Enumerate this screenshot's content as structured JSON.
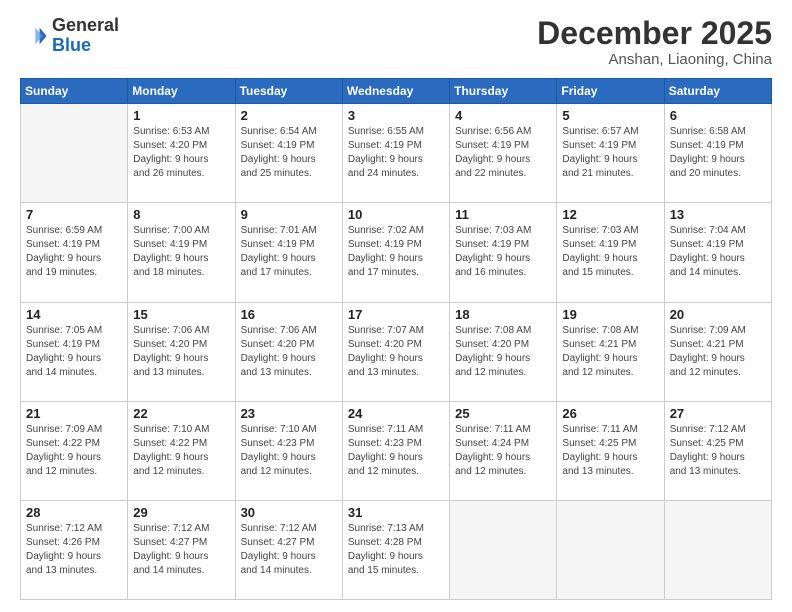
{
  "logo": {
    "line1": "General",
    "line2": "Blue"
  },
  "header": {
    "month": "December 2025",
    "location": "Anshan, Liaoning, China"
  },
  "days_of_week": [
    "Sunday",
    "Monday",
    "Tuesday",
    "Wednesday",
    "Thursday",
    "Friday",
    "Saturday"
  ],
  "weeks": [
    [
      {
        "day": "",
        "info": ""
      },
      {
        "day": "1",
        "info": "Sunrise: 6:53 AM\nSunset: 4:20 PM\nDaylight: 9 hours\nand 26 minutes."
      },
      {
        "day": "2",
        "info": "Sunrise: 6:54 AM\nSunset: 4:19 PM\nDaylight: 9 hours\nand 25 minutes."
      },
      {
        "day": "3",
        "info": "Sunrise: 6:55 AM\nSunset: 4:19 PM\nDaylight: 9 hours\nand 24 minutes."
      },
      {
        "day": "4",
        "info": "Sunrise: 6:56 AM\nSunset: 4:19 PM\nDaylight: 9 hours\nand 22 minutes."
      },
      {
        "day": "5",
        "info": "Sunrise: 6:57 AM\nSunset: 4:19 PM\nDaylight: 9 hours\nand 21 minutes."
      },
      {
        "day": "6",
        "info": "Sunrise: 6:58 AM\nSunset: 4:19 PM\nDaylight: 9 hours\nand 20 minutes."
      }
    ],
    [
      {
        "day": "7",
        "info": "Sunrise: 6:59 AM\nSunset: 4:19 PM\nDaylight: 9 hours\nand 19 minutes."
      },
      {
        "day": "8",
        "info": "Sunrise: 7:00 AM\nSunset: 4:19 PM\nDaylight: 9 hours\nand 18 minutes."
      },
      {
        "day": "9",
        "info": "Sunrise: 7:01 AM\nSunset: 4:19 PM\nDaylight: 9 hours\nand 17 minutes."
      },
      {
        "day": "10",
        "info": "Sunrise: 7:02 AM\nSunset: 4:19 PM\nDaylight: 9 hours\nand 17 minutes."
      },
      {
        "day": "11",
        "info": "Sunrise: 7:03 AM\nSunset: 4:19 PM\nDaylight: 9 hours\nand 16 minutes."
      },
      {
        "day": "12",
        "info": "Sunrise: 7:03 AM\nSunset: 4:19 PM\nDaylight: 9 hours\nand 15 minutes."
      },
      {
        "day": "13",
        "info": "Sunrise: 7:04 AM\nSunset: 4:19 PM\nDaylight: 9 hours\nand 14 minutes."
      }
    ],
    [
      {
        "day": "14",
        "info": "Sunrise: 7:05 AM\nSunset: 4:19 PM\nDaylight: 9 hours\nand 14 minutes."
      },
      {
        "day": "15",
        "info": "Sunrise: 7:06 AM\nSunset: 4:20 PM\nDaylight: 9 hours\nand 13 minutes."
      },
      {
        "day": "16",
        "info": "Sunrise: 7:06 AM\nSunset: 4:20 PM\nDaylight: 9 hours\nand 13 minutes."
      },
      {
        "day": "17",
        "info": "Sunrise: 7:07 AM\nSunset: 4:20 PM\nDaylight: 9 hours\nand 13 minutes."
      },
      {
        "day": "18",
        "info": "Sunrise: 7:08 AM\nSunset: 4:20 PM\nDaylight: 9 hours\nand 12 minutes."
      },
      {
        "day": "19",
        "info": "Sunrise: 7:08 AM\nSunset: 4:21 PM\nDaylight: 9 hours\nand 12 minutes."
      },
      {
        "day": "20",
        "info": "Sunrise: 7:09 AM\nSunset: 4:21 PM\nDaylight: 9 hours\nand 12 minutes."
      }
    ],
    [
      {
        "day": "21",
        "info": "Sunrise: 7:09 AM\nSunset: 4:22 PM\nDaylight: 9 hours\nand 12 minutes."
      },
      {
        "day": "22",
        "info": "Sunrise: 7:10 AM\nSunset: 4:22 PM\nDaylight: 9 hours\nand 12 minutes."
      },
      {
        "day": "23",
        "info": "Sunrise: 7:10 AM\nSunset: 4:23 PM\nDaylight: 9 hours\nand 12 minutes."
      },
      {
        "day": "24",
        "info": "Sunrise: 7:11 AM\nSunset: 4:23 PM\nDaylight: 9 hours\nand 12 minutes."
      },
      {
        "day": "25",
        "info": "Sunrise: 7:11 AM\nSunset: 4:24 PM\nDaylight: 9 hours\nand 12 minutes."
      },
      {
        "day": "26",
        "info": "Sunrise: 7:11 AM\nSunset: 4:25 PM\nDaylight: 9 hours\nand 13 minutes."
      },
      {
        "day": "27",
        "info": "Sunrise: 7:12 AM\nSunset: 4:25 PM\nDaylight: 9 hours\nand 13 minutes."
      }
    ],
    [
      {
        "day": "28",
        "info": "Sunrise: 7:12 AM\nSunset: 4:26 PM\nDaylight: 9 hours\nand 13 minutes."
      },
      {
        "day": "29",
        "info": "Sunrise: 7:12 AM\nSunset: 4:27 PM\nDaylight: 9 hours\nand 14 minutes."
      },
      {
        "day": "30",
        "info": "Sunrise: 7:12 AM\nSunset: 4:27 PM\nDaylight: 9 hours\nand 14 minutes."
      },
      {
        "day": "31",
        "info": "Sunrise: 7:13 AM\nSunset: 4:28 PM\nDaylight: 9 hours\nand 15 minutes."
      },
      {
        "day": "",
        "info": ""
      },
      {
        "day": "",
        "info": ""
      },
      {
        "day": "",
        "info": ""
      }
    ]
  ]
}
